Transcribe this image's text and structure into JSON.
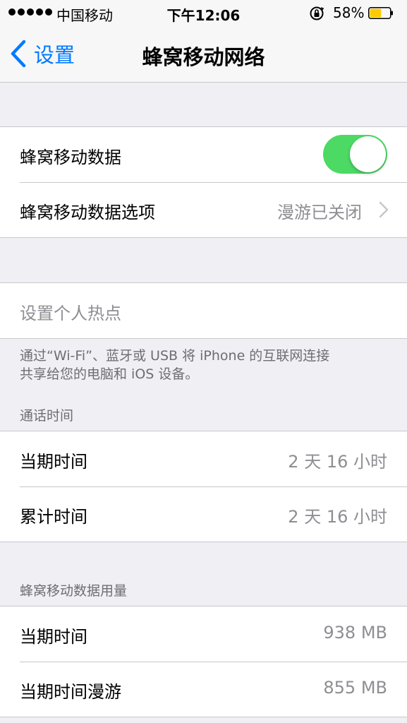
{
  "status_bar": {
    "carrier": "中国移动",
    "time": "下午12:06",
    "battery_percent": "58%",
    "battery_level": 0.58,
    "battery_color": "#ffcc00"
  },
  "nav": {
    "back_label": "设置",
    "title": "蜂窝移动网络",
    "accent_color": "#007aff"
  },
  "cellular": {
    "data_label": "蜂窝移动数据",
    "data_enabled": true,
    "toggle_color": "#4cd964",
    "options_label": "蜂窝移动数据选项",
    "options_value": "漫游已关闭"
  },
  "hotspot": {
    "label": "设置个人热点",
    "footer_line1": "通过“Wi-Fi”、蓝牙或 USB 将 iPhone 的互联网连接",
    "footer_line2": "共享给您的电脑和 iOS 设备。"
  },
  "call_time": {
    "header": "通话时间",
    "rows": [
      {
        "label": "当期时间",
        "value": "2 天 16 小时"
      },
      {
        "label": "累计时间",
        "value": "2 天 16 小时"
      }
    ]
  },
  "data_usage": {
    "header": "蜂窝移动数据用量",
    "rows": [
      {
        "label": "当期时间",
        "value": "938 MB"
      },
      {
        "label": "当期时间漫游",
        "value": "855 MB"
      }
    ]
  },
  "icons": {
    "back": "chevron-left-icon",
    "disclosure": "chevron-right-icon",
    "rotation_lock": "rotation-lock-icon",
    "battery": "battery-icon",
    "signal": "signal-dots-icon"
  }
}
